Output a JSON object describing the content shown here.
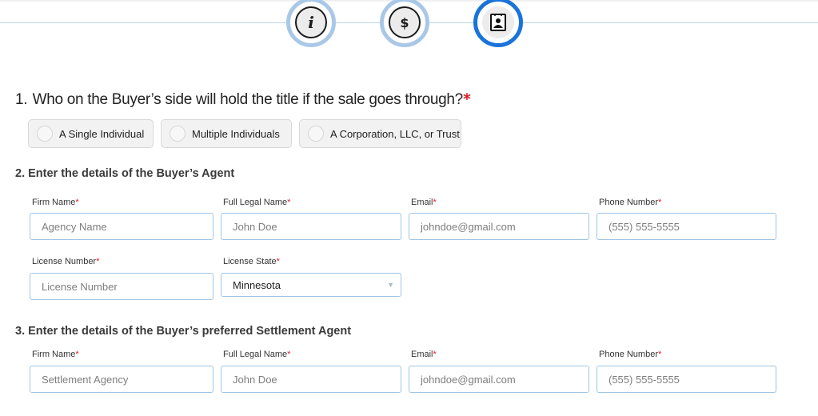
{
  "stepper": {
    "steps": [
      {
        "icon": "info-icon",
        "state": "done"
      },
      {
        "icon": "dollar-icon",
        "state": "done"
      },
      {
        "icon": "contact-card-icon",
        "state": "active"
      }
    ]
  },
  "q1": {
    "number": "1.",
    "text": "Who on the Buyer’s side will hold the title if the sale goes through?",
    "required": "*",
    "options": [
      "A Single Individual",
      "Multiple Individuals",
      "A Corporation, LLC, or Trust"
    ]
  },
  "buyer_agent": {
    "heading": "2. Enter the details of the Buyer’s Agent",
    "firm_name": {
      "label": "Firm Name",
      "placeholder": "Agency Name"
    },
    "full_legal_name": {
      "label": "Full Legal Name",
      "placeholder": "John Doe"
    },
    "email": {
      "label": "Email",
      "placeholder": "johndoe@gmail.com"
    },
    "phone": {
      "label": "Phone Number",
      "placeholder": "(555) 555-5555"
    },
    "license_number": {
      "label": "License Number",
      "placeholder": "License Number"
    },
    "license_state": {
      "label": "License State",
      "value": "Minnesota"
    }
  },
  "settlement_agent": {
    "heading": "3. Enter the details of the Buyer’s preferred Settlement Agent",
    "firm_name": {
      "label": "Firm Name",
      "placeholder": "Settlement Agency"
    },
    "full_legal_name": {
      "label": "Full Legal Name",
      "placeholder": "John Doe"
    },
    "email": {
      "label": "Email",
      "placeholder": "johndoe@gmail.com"
    },
    "phone": {
      "label": "Phone Number",
      "placeholder": "(555) 555-5555"
    }
  },
  "req_mark": "*"
}
